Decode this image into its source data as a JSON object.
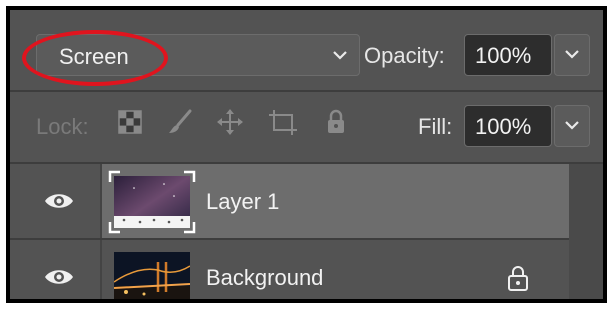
{
  "blend_mode": {
    "value": "Screen"
  },
  "opacity": {
    "label": "Opacity:",
    "value": "100%"
  },
  "lock": {
    "label": "Lock:"
  },
  "fill": {
    "label": "Fill:",
    "value": "100%"
  },
  "layers": [
    {
      "name": "Layer 1",
      "selected": true
    },
    {
      "name": "Background",
      "selected": false
    }
  ],
  "colors": {
    "highlight": "#e0141e",
    "panel": "#535353",
    "selected_row": "#6d6d6d"
  }
}
